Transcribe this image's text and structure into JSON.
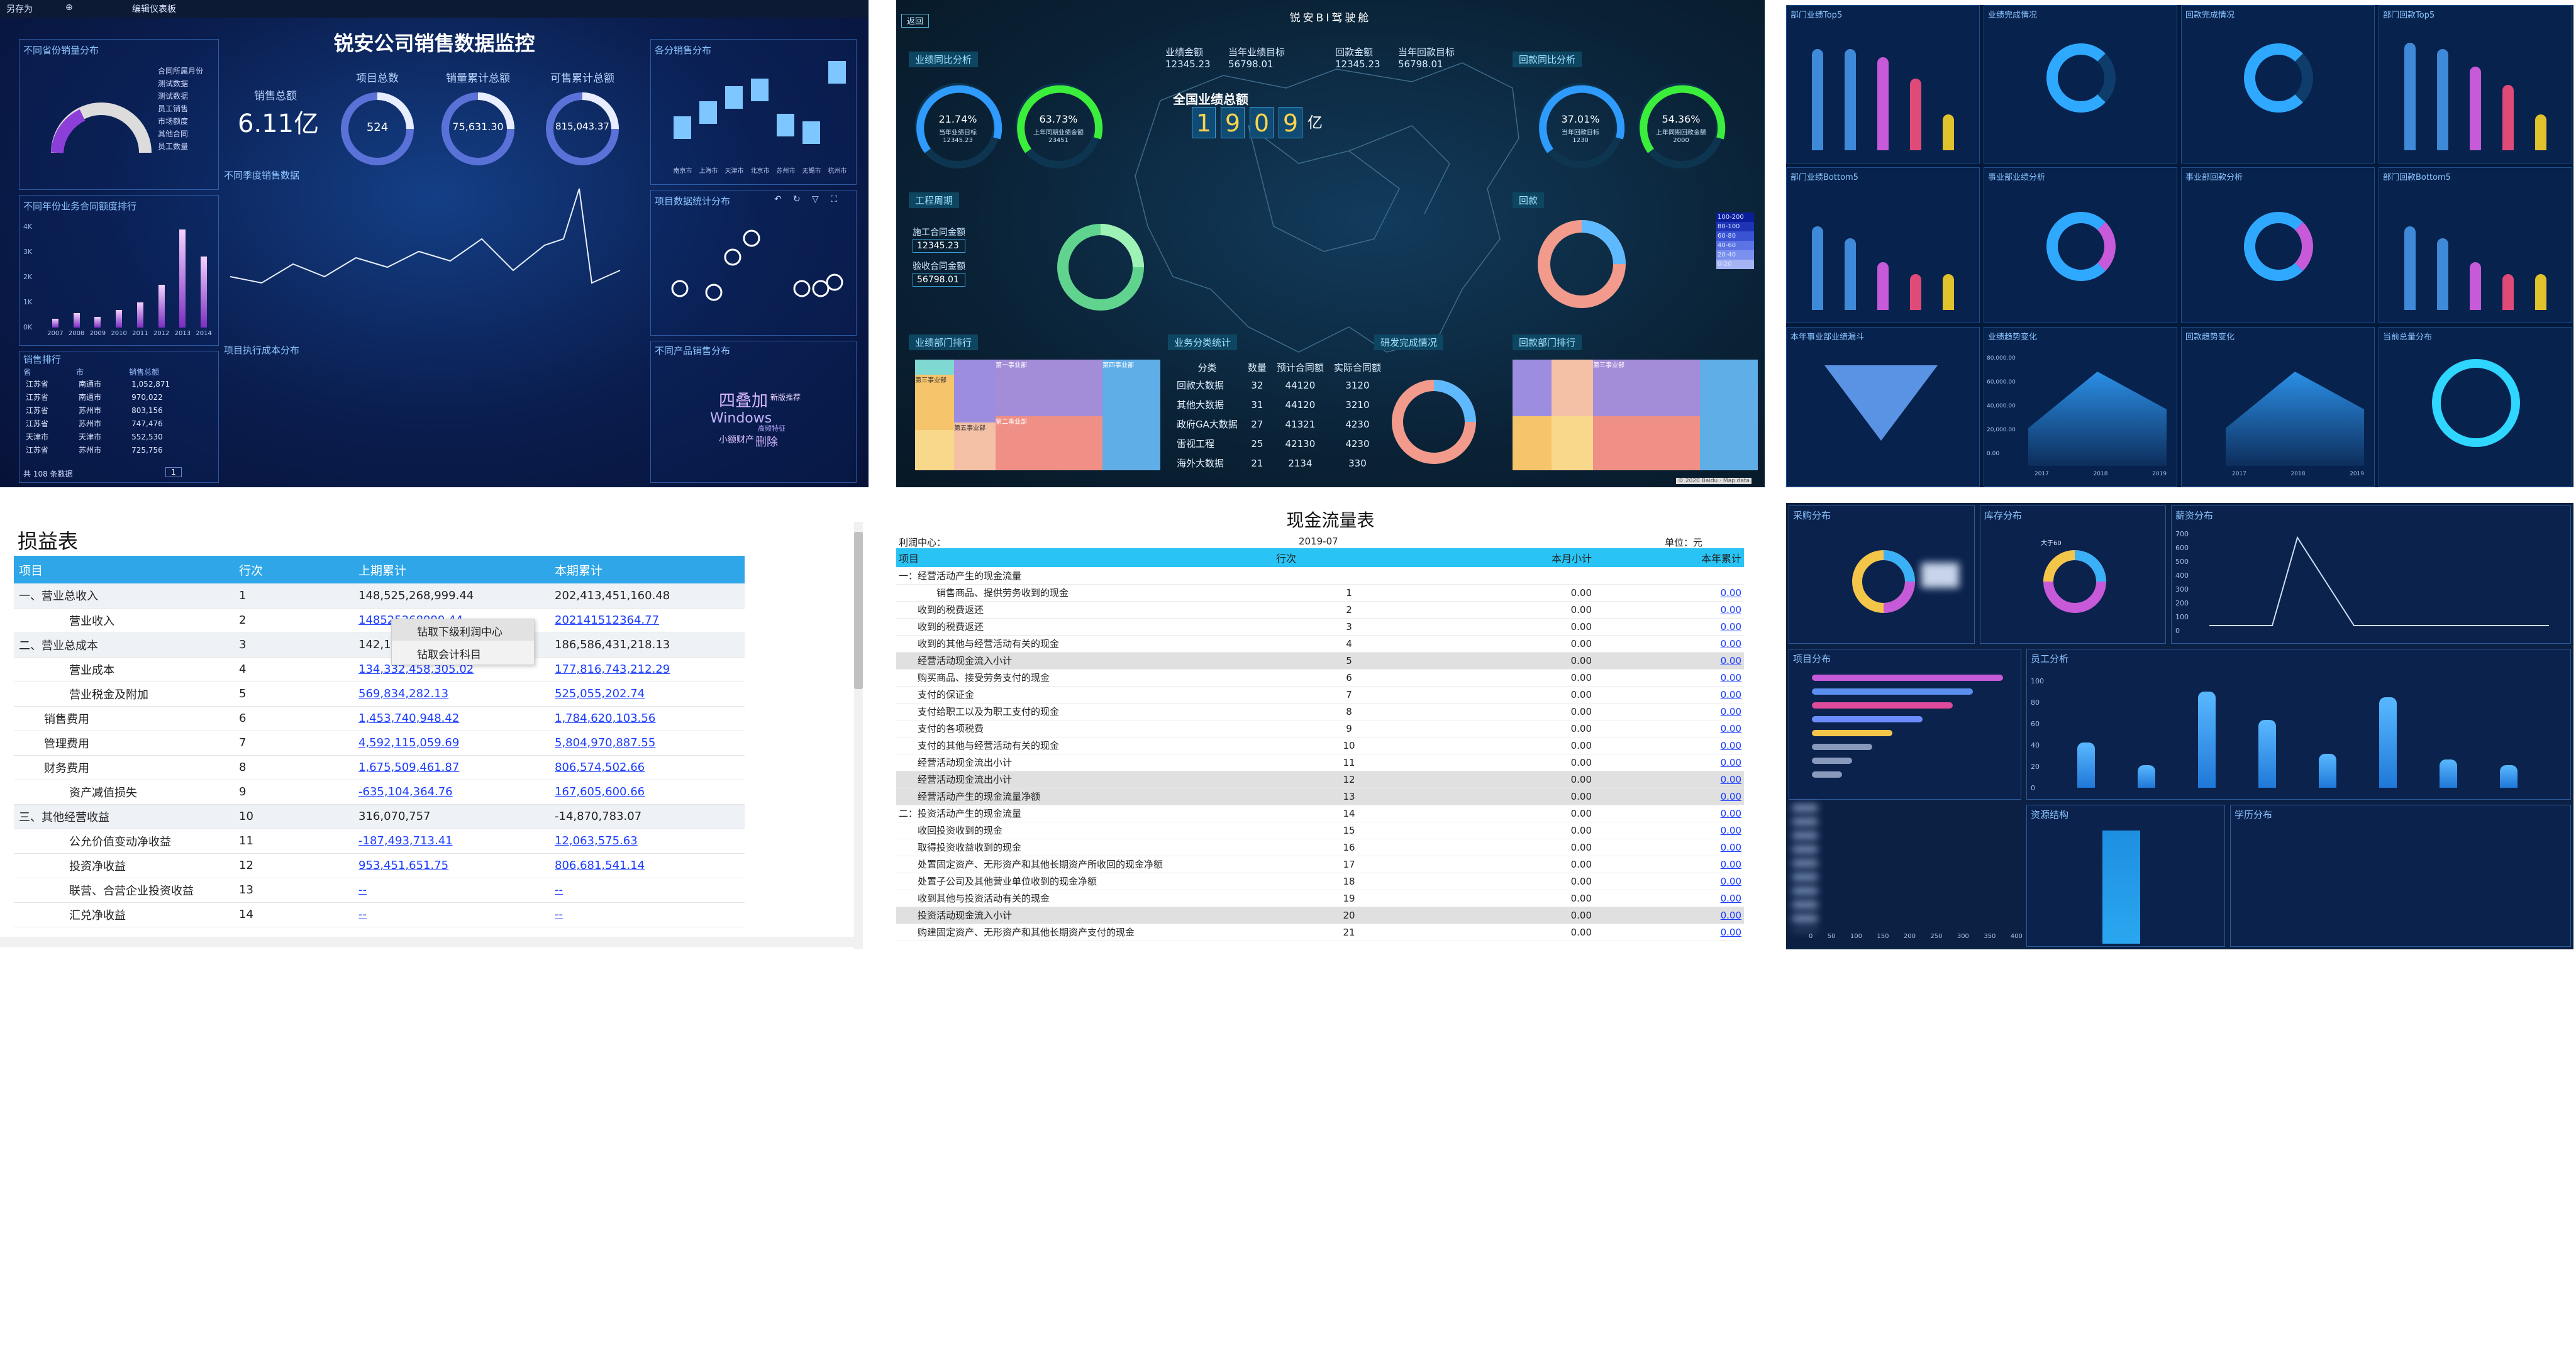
{
  "tile1": {
    "toolbar": [
      "另存为",
      "⊕",
      "编辑仪表板"
    ],
    "title": "锐安公司销售数据监控",
    "panel_gauge_title": "不同省份销量分布",
    "kpis": [
      {
        "label": "销售总额",
        "value": "6.11亿"
      },
      {
        "label": "项目总数",
        "value": "524"
      },
      {
        "label": "销量累计总额",
        "value": "75,631.30"
      },
      {
        "label": "可售累计总额",
        "value": "815,043.37"
      }
    ],
    "legend_items": [
      "合同所属月份",
      "测试数据",
      "测试数据",
      "员工销售",
      "市场额度",
      "其他合同",
      "员工数量"
    ],
    "line_title": "不同季度销售数据",
    "bar_title": "不同年份业务合同额度排行",
    "bar_years": [
      "2007",
      "2008",
      "2009",
      "2010",
      "2011",
      "2012",
      "2013",
      "2014"
    ],
    "bar_values": [
      5,
      8,
      6,
      10,
      14,
      24,
      55,
      40
    ],
    "bar_ylabels": [
      "4K",
      "3K",
      "2K",
      "1K",
      "0K"
    ],
    "sales_table_title": "销售排行",
    "sales_table_headers": [
      "省",
      "市",
      "销售总额"
    ],
    "sales_rows": [
      [
        "江苏省",
        "南通市",
        "1,052,871"
      ],
      [
        "江苏省",
        "南通市",
        "970,022"
      ],
      [
        "江苏省",
        "苏州市",
        "803,156"
      ],
      [
        "江苏省",
        "苏州市",
        "747,476"
      ],
      [
        "天津市",
        "天津市",
        "552,530"
      ],
      [
        "江苏省",
        "苏州市",
        "725,756"
      ]
    ],
    "table_footer": "共 108 条数据",
    "pager": "1",
    "neg_bar_title": "项目执行成本分布",
    "right_bar_title": "各分销售分布",
    "right_bar_values": [
      18,
      30,
      42,
      48,
      20,
      14,
      62
    ],
    "right_bar_cats": [
      "南京市",
      "上海市",
      "天津市",
      "北京市",
      "苏州市",
      "无锡市",
      "杭州市"
    ],
    "scatter_title": "项目数据统计分布",
    "word_title": "不同产品销售分布",
    "words": [
      "四叠加",
      "Windows",
      "新版推荐",
      "小额财产",
      "高频特征",
      "删除"
    ]
  },
  "tile2": {
    "top_button": "返回",
    "title": "锐安BI驾驶舱",
    "stats": [
      {
        "label": "业绩金额",
        "value": "12345.23"
      },
      {
        "label": "当年业绩目标",
        "value": "56798.01"
      },
      {
        "label": "回款金额",
        "value": "12345.23"
      },
      {
        "label": "当年回款目标",
        "value": "56798.01"
      }
    ],
    "total_label": "全国业绩总额",
    "total_digits": [
      "1",
      "9",
      "0",
      "9"
    ],
    "total_unit": "亿",
    "left_gauges_title": "业绩同比分析",
    "left_gauge1": {
      "pct": "21.74%",
      "sub": "当年业绩目标",
      "num": "12345.23"
    },
    "left_gauge2": {
      "pct": "63.73%",
      "sub": "上年同期业绩金额",
      "num": "23451"
    },
    "eng_title": "工程周期",
    "eng_rows": [
      {
        "label": "施工合同金额",
        "value": "12345.23"
      },
      {
        "label": "验收合同金额",
        "value": "56798.01"
      }
    ],
    "right_gauges_title": "回款同比分析",
    "right_gauge1": {
      "pct": "37.01%",
      "sub": "当年回款目标",
      "num": "1230"
    },
    "right_gauge2": {
      "pct": "54.36%",
      "sub": "上年同期回款金额",
      "num": "2000"
    },
    "right_ring_title": "回款",
    "scale": [
      "100-200",
      "80-100",
      "60-80",
      "40-60",
      "20-40",
      "0-20"
    ],
    "bottom_left_title": "业绩部门排行",
    "bottom_center_title": "业务分类统计",
    "table_headers": [
      "分类",
      "数量",
      "预计合同额",
      "实际合同额"
    ],
    "table_rows": [
      [
        "回款大数据",
        "32",
        "44120",
        "3120"
      ],
      [
        "其他大数据",
        "31",
        "44120",
        "3210"
      ],
      [
        "政府GA大数据",
        "27",
        "41321",
        "4230"
      ],
      [
        "雷视工程",
        "25",
        "42130",
        "4230"
      ],
      [
        "海外大数据",
        "21",
        "2134",
        "330"
      ]
    ],
    "bottom_right_ring_title": "研发完成情况",
    "bottom_right_title": "回款部门排行",
    "treemap_labels": [
      "第三事业部",
      "第五事业部",
      "第一事业部",
      "第二事业部",
      "第四事业部"
    ],
    "attribution": "© 2020 Baidu · Map data"
  },
  "tile3": {
    "panel_titles": [
      "部门业绩Top5",
      "业绩完成情况",
      "回款完成情况",
      "部门回款Top5",
      "部门业绩Bottom5",
      "事业部业绩分析",
      "事业部回款分析",
      "部门回款Bottom5",
      "本年事业部业绩漏斗",
      "业绩趋势变化",
      "回款趋势变化",
      "当前总量分布"
    ],
    "bars_a": [
      85,
      85,
      78,
      60,
      30
    ],
    "bars_b": [
      90,
      85,
      70,
      55,
      30
    ],
    "bars_c": [
      70,
      60,
      40,
      30,
      30
    ],
    "y_axis": [
      "80,000.00",
      "60,000.00",
      "40,000.00",
      "20,000.00",
      "0.00"
    ],
    "x_years": [
      "2017",
      "2018",
      "2019"
    ]
  },
  "tile4": {
    "title": "损益表",
    "headers": [
      "项目",
      "行次",
      "上期累计",
      "本期累计"
    ],
    "rows": [
      {
        "item": "一、营业总收入",
        "line": "1",
        "prev": "148,525,268,999.44",
        "curr": "202,413,451,160.48",
        "link": false,
        "indent": 0
      },
      {
        "item": "营业收入",
        "line": "2",
        "prev": "148525268999.44",
        "curr": "202141512364.77",
        "link": true,
        "indent": 2
      },
      {
        "item": "二、营业总成本",
        "line": "3",
        "prev": "142,11",
        "curr": "186,586,431,218.13",
        "link": false,
        "indent": 0
      },
      {
        "item": "营业成本",
        "line": "4",
        "prev": "134,332,458,305.02",
        "curr": "177,816,743,212.29",
        "link": true,
        "indent": 2
      },
      {
        "item": "营业税金及附加",
        "line": "5",
        "prev": "569,834,282.13",
        "curr": "525,055,202.74",
        "link": true,
        "indent": 2
      },
      {
        "item": "销售费用",
        "line": "6",
        "prev": "1,453,740,948.42",
        "curr": "1,784,620,103.56",
        "link": true,
        "indent": 1
      },
      {
        "item": "管理费用",
        "line": "7",
        "prev": "4,592,115,059.69",
        "curr": "5,804,970,887.55",
        "link": true,
        "indent": 1
      },
      {
        "item": "财务费用",
        "line": "8",
        "prev": "1,675,509,461.87",
        "curr": "806,574,502.66",
        "link": true,
        "indent": 1
      },
      {
        "item": "资产减值损失",
        "line": "9",
        "prev": "-635,104,364.76",
        "curr": "167,605,600.66",
        "link": true,
        "indent": 2
      },
      {
        "item": "三、其他经营收益",
        "line": "10",
        "prev": "316,070,757",
        "curr": "-14,870,783.07",
        "link": false,
        "indent": 0
      },
      {
        "item": "公允价值变动净收益",
        "line": "11",
        "prev": "-187,493,713.41",
        "curr": "12,063,575.63",
        "link": true,
        "indent": 2
      },
      {
        "item": "投资净收益",
        "line": "12",
        "prev": "953,451,651.75",
        "curr": "806,681,541.14",
        "link": true,
        "indent": 2
      },
      {
        "item": "联营、合营企业投资收益",
        "line": "13",
        "prev": "--",
        "curr": "--",
        "link": true,
        "indent": 2
      },
      {
        "item": "汇兑净收益",
        "line": "14",
        "prev": "--",
        "curr": "--",
        "link": true,
        "indent": 2
      }
    ],
    "context_menu": [
      "钻取下级利润中心",
      "钻取会计科目"
    ]
  },
  "tile5": {
    "title": "现金流量表",
    "meta_left": "利润中心：",
    "meta_mid": "2019-07",
    "meta_right": "单位：元",
    "headers": [
      "项目",
      "行次",
      "本月小计",
      "本年累计"
    ],
    "rows": [
      {
        "item": "一：经营活动产生的现金流量",
        "line": "",
        "m": "",
        "y": "",
        "grey": false,
        "indent": 0
      },
      {
        "item": "销售商品、提供劳务收到的现金",
        "line": "1",
        "m": "0.00",
        "y": "0.00",
        "grey": false,
        "indent": 2
      },
      {
        "item": "收到的税费返还",
        "line": "2",
        "m": "0.00",
        "y": "0.00",
        "grey": false,
        "indent": 1
      },
      {
        "item": "收到的税费返还",
        "line": "3",
        "m": "0.00",
        "y": "0.00",
        "grey": false,
        "indent": 1
      },
      {
        "item": "收到的其他与经营活动有关的现金",
        "line": "4",
        "m": "0.00",
        "y": "0.00",
        "grey": false,
        "indent": 1
      },
      {
        "item": "经营活动现金流入小计",
        "line": "5",
        "m": "0.00",
        "y": "0.00",
        "grey": true,
        "indent": 1
      },
      {
        "item": "购买商品、接受劳务支付的现金",
        "line": "6",
        "m": "0.00",
        "y": "0.00",
        "grey": false,
        "indent": 1
      },
      {
        "item": "支付的保证金",
        "line": "7",
        "m": "0.00",
        "y": "0.00",
        "grey": false,
        "indent": 1
      },
      {
        "item": "支付给职工以及为职工支付的现金",
        "line": "8",
        "m": "0.00",
        "y": "0.00",
        "grey": false,
        "indent": 1
      },
      {
        "item": "支付的各项税费",
        "line": "9",
        "m": "0.00",
        "y": "0.00",
        "grey": false,
        "indent": 1
      },
      {
        "item": "支付的其他与经营活动有关的现金",
        "line": "10",
        "m": "0.00",
        "y": "0.00",
        "grey": false,
        "indent": 1
      },
      {
        "item": "经营活动现金流出小计",
        "line": "11",
        "m": "0.00",
        "y": "0.00",
        "grey": false,
        "indent": 1
      },
      {
        "item": "经营活动现金流出小计",
        "line": "12",
        "m": "0.00",
        "y": "0.00",
        "grey": true,
        "indent": 1
      },
      {
        "item": "经营活动产生的现金流量净额",
        "line": "13",
        "m": "0.00",
        "y": "0.00",
        "grey": true,
        "indent": 1
      },
      {
        "item": "二：投资活动产生的现金流量",
        "line": "14",
        "m": "0.00",
        "y": "0.00",
        "grey": false,
        "indent": 0
      },
      {
        "item": "收回投资收到的现金",
        "line": "15",
        "m": "0.00",
        "y": "0.00",
        "grey": false,
        "indent": 1
      },
      {
        "item": "取得投资收益收到的现金",
        "line": "16",
        "m": "0.00",
        "y": "0.00",
        "grey": false,
        "indent": 1
      },
      {
        "item": "处置固定资产、无形资产和其他长期资产所收回的现金净额",
        "line": "17",
        "m": "0.00",
        "y": "0.00",
        "grey": false,
        "indent": 1
      },
      {
        "item": "处置子公司及其他营业单位收到的现金净额",
        "line": "18",
        "m": "0.00",
        "y": "0.00",
        "grey": false,
        "indent": 1
      },
      {
        "item": "收到其他与投资活动有关的现金",
        "line": "19",
        "m": "0.00",
        "y": "0.00",
        "grey": false,
        "indent": 1
      },
      {
        "item": "投资活动现金流入小计",
        "line": "20",
        "m": "0.00",
        "y": "0.00",
        "grey": true,
        "indent": 1
      },
      {
        "item": "购建固定资产、无形资产和其他长期资产支付的现金",
        "line": "21",
        "m": "0.00",
        "y": "0.00",
        "grey": false,
        "indent": 1
      }
    ]
  },
  "tile6": {
    "panel_titles": [
      "采购分布",
      "库存分布",
      "薪资分布",
      "项目分布",
      "员工分析",
      "资源结构",
      "学历分布"
    ],
    "line_y": [
      "700",
      "600",
      "500",
      "400",
      "300",
      "200",
      "100",
      "0"
    ],
    "col_y": [
      "100",
      "80",
      "60",
      "40",
      "20",
      "0"
    ],
    "hbar_x": [
      "0",
      "50",
      "100",
      "150",
      "200",
      "250",
      "300",
      "350",
      "400"
    ],
    "hbars": [
      95,
      80,
      70,
      55,
      40,
      30,
      20,
      15
    ],
    "col_vals": [
      40,
      20,
      85,
      60,
      30,
      80,
      25,
      20
    ],
    "ring_label": "大于60"
  }
}
